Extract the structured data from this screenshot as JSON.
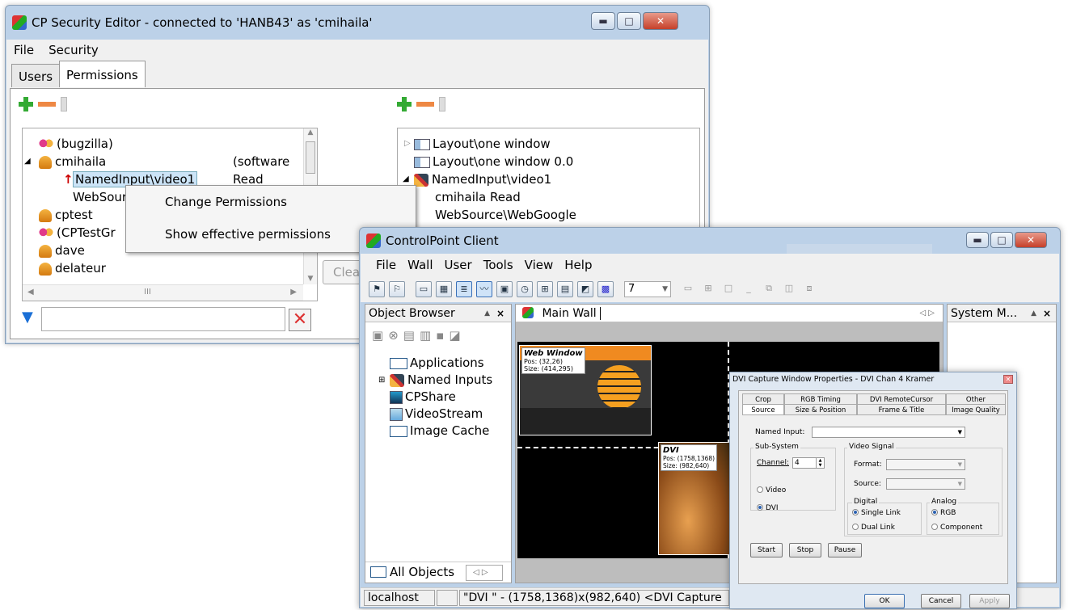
{
  "win1": {
    "title": "CP Security Editor - connected to 'HANB43' as 'cmihaila'",
    "menu": [
      "File",
      "Security"
    ],
    "tabs": [
      "Users",
      "Permissions"
    ],
    "left_tree": [
      {
        "name": "(bugzilla)",
        "icon": "group-icon",
        "extra": ""
      },
      {
        "name": "cmihaila",
        "icon": "user-icon",
        "extra": "(software"
      },
      {
        "name": "NamedInput\\video1",
        "icon": "",
        "extra": "Read"
      },
      {
        "name": "WebSour",
        "icon": "",
        "extra": ""
      },
      {
        "name": "cptest",
        "icon": "user-icon",
        "extra": ""
      },
      {
        "name": "(CPTestGr",
        "icon": "group-icon",
        "extra": ""
      },
      {
        "name": "dave",
        "icon": "user-icon",
        "extra": ""
      },
      {
        "name": "delateur",
        "icon": "user-icon",
        "extra": ""
      }
    ],
    "scroll_mid": "III",
    "right_tree": [
      {
        "name": "Layout\\one window",
        "icon": "layout-icon"
      },
      {
        "name": "Layout\\one window 0.0",
        "icon": "layout-icon"
      },
      {
        "name": "NamedInput\\video1",
        "icon": "plug-icon"
      },
      {
        "name": "cmihaila  Read",
        "icon": ""
      },
      {
        "name": "WebSource\\WebGoogle",
        "icon": ""
      }
    ],
    "clear_label": "Clea",
    "filter_value": "",
    "context_menu": [
      "Change Permissions",
      "Show effective permissions"
    ]
  },
  "win2": {
    "title": "ControlPoint Client",
    "menu": [
      "File",
      "Wall",
      "User",
      "Tools",
      "View",
      "Help"
    ],
    "layout_combo": "7",
    "object_browser": "Object Browser",
    "objects": [
      "Applications",
      "Named Inputs",
      "CPShare",
      "VideoStream",
      "Image Cache"
    ],
    "all_objects_tab": "All Objects",
    "main_wall_tab": "Main Wall",
    "system_tab": "System M...",
    "web_window": {
      "title": "Web Window",
      "pos": "Pos: (32,26)",
      "size": "Size: (414,295)"
    },
    "dvi_window": {
      "title": "DVI",
      "pos": "Pos: (1758,1368)",
      "size": "Size: (982,640)"
    },
    "status": {
      "host": "localhost",
      "middle": "",
      "text": "\"DVI \" - (1758,1368)x(982,640) <DVI Capture"
    }
  },
  "dialog": {
    "title": "DVI Capture Window Properties - DVI Chan 4 Kramer",
    "tabs_row1": [
      "Crop",
      "RGB Timing",
      "DVI RemoteCursor",
      "Other"
    ],
    "tabs_row2": [
      "Source",
      "Size & Position",
      "Frame & Title",
      "Image Quality"
    ],
    "named_input_label": "Named Input:",
    "named_input_value": "",
    "subsystem_label": "Sub-System",
    "channel_label": "Channel:",
    "channel_value": "4",
    "video_label": "Video",
    "dvi_label": "DVI",
    "video_signal_label": "Video Signal",
    "format_label": "Format:",
    "source_label": "Source:",
    "digital_label": "Digital",
    "single_link": "Single Link",
    "dual_link": "Dual Link",
    "analog_label": "Analog",
    "rgb_label": "RGB",
    "component_label": "Component",
    "start": "Start",
    "stop": "Stop",
    "pause": "Pause",
    "ok": "OK",
    "cancel": "Cancel",
    "apply": "Apply"
  }
}
